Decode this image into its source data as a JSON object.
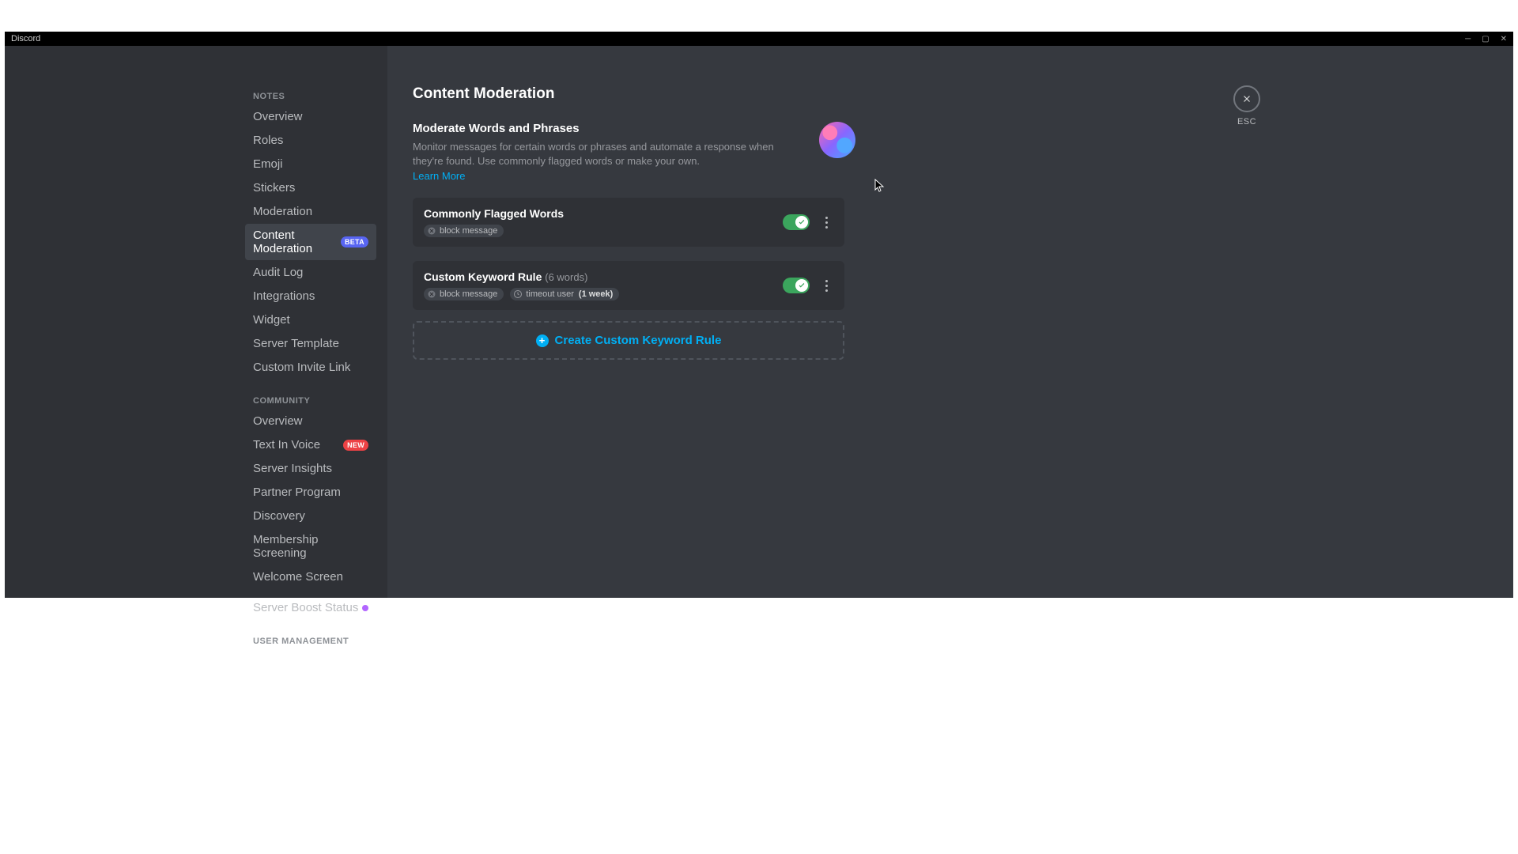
{
  "window": {
    "title": "Discord"
  },
  "sidebar": {
    "sections": [
      {
        "header": "NOTES",
        "items": [
          {
            "label": "Overview"
          },
          {
            "label": "Roles"
          },
          {
            "label": "Emoji"
          },
          {
            "label": "Stickers"
          },
          {
            "label": "Moderation"
          },
          {
            "label": "Content Moderation",
            "active": true,
            "badge": "BETA"
          },
          {
            "label": "Audit Log"
          },
          {
            "label": "Integrations"
          },
          {
            "label": "Widget"
          },
          {
            "label": "Server Template"
          },
          {
            "label": "Custom Invite Link"
          }
        ]
      },
      {
        "header": "COMMUNITY",
        "items": [
          {
            "label": "Overview"
          },
          {
            "label": "Text In Voice",
            "badge": "NEW"
          },
          {
            "label": "Server Insights"
          },
          {
            "label": "Partner Program"
          },
          {
            "label": "Discovery"
          },
          {
            "label": "Membership Screening"
          },
          {
            "label": "Welcome Screen"
          },
          {
            "label": "Server Boost Status",
            "boost": true
          }
        ]
      },
      {
        "header": "USER MANAGEMENT",
        "items": []
      }
    ]
  },
  "main": {
    "title": "Content Moderation",
    "intro": {
      "heading": "Moderate Words and Phrases",
      "desc": "Monitor messages for certain words or phrases and automate a response when they're found. Use commonly flagged words or make your own.",
      "learn": "Learn More"
    },
    "rules": [
      {
        "title": "Commonly Flagged Words",
        "count": "",
        "chips": [
          {
            "icon": "block",
            "label": "block message"
          }
        ],
        "on": true
      },
      {
        "title": "Custom Keyword Rule",
        "count": "(6 words)",
        "chips": [
          {
            "icon": "block",
            "label": "block message"
          },
          {
            "icon": "clock",
            "label": "timeout user",
            "detail": "(1 week)"
          }
        ],
        "on": true
      }
    ],
    "create": "Create Custom Keyword Rule",
    "esc": "ESC"
  }
}
